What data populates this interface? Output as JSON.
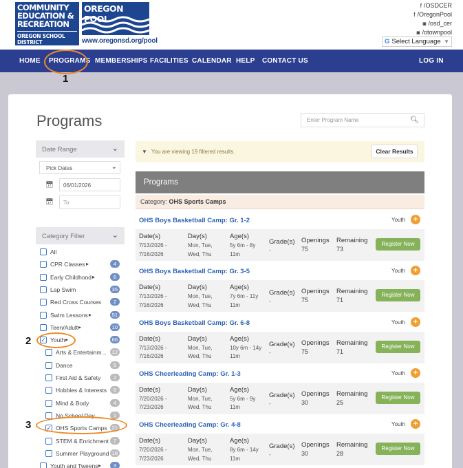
{
  "header": {
    "logo_lines": [
      "COMMUNITY",
      "EDUCATION &",
      "RECREATION"
    ],
    "logo_sub": "OREGON SCHOOL DISTRICT",
    "pool_logo": "OREGON POOL",
    "pool_url": "www.oregonsd.org/pool",
    "social": [
      "/OSDCER",
      "/OregonPool",
      "/osd_cer",
      "/otownpool"
    ],
    "social_icons": [
      "facebook-icon",
      "facebook-icon",
      "instagram-icon",
      "instagram-icon"
    ],
    "language_label": "Select Language",
    "language_arrow": "▼"
  },
  "nav": {
    "items": [
      "HOME",
      "PROGRAMS",
      "MEMBERSHIPS",
      "FACILITIES",
      "CALENDAR",
      "HELP",
      "CONTACT US"
    ],
    "login": "LOG IN"
  },
  "annotations": {
    "n1": "1",
    "n2": "2",
    "n3": "3"
  },
  "page": {
    "title": "Programs",
    "search_placeholder": "Enter Program Name"
  },
  "sidebar": {
    "date_range": {
      "header": "Date Range",
      "pick_dates": "Pick Dates",
      "start": "06/01/2026",
      "end_placeholder": "To"
    },
    "category": {
      "header": "Category Filter",
      "items": [
        {
          "label": "All",
          "count": "",
          "checked": false,
          "arrow": false
        },
        {
          "label": "CPR Classes",
          "count": "4",
          "checked": false,
          "arrow": true
        },
        {
          "label": "Early Childhood",
          "count": "6",
          "checked": false,
          "arrow": true
        },
        {
          "label": "Lap Swim",
          "count": "35",
          "checked": false,
          "arrow": false
        },
        {
          "label": "Red Cross Courses",
          "count": "2",
          "checked": false,
          "arrow": false
        },
        {
          "label": "Swim Lessons",
          "count": "51",
          "checked": false,
          "arrow": true
        },
        {
          "label": "Teen/Adult",
          "count": "10",
          "checked": false,
          "arrow": true
        },
        {
          "label": "Youth",
          "count": "66",
          "checked": true,
          "arrow": true
        }
      ],
      "youth_sub": [
        {
          "label": "Arts & Entertainm...",
          "count": "12",
          "checked": false
        },
        {
          "label": "Dance",
          "count": "5",
          "checked": false
        },
        {
          "label": "First Aid & Safety",
          "count": "2",
          "checked": false
        },
        {
          "label": "Hobbies & Interests",
          "count": "6",
          "checked": false
        },
        {
          "label": "Mind & Body",
          "count": "4",
          "checked": false
        },
        {
          "label": "No School Day",
          "count": "1",
          "checked": false
        },
        {
          "label": "OHS Sports Camps",
          "count": "21",
          "checked": true
        },
        {
          "label": "STEM & Enrichment",
          "count": "7",
          "checked": false
        },
        {
          "label": "Summer Playground",
          "count": "18",
          "checked": false
        }
      ],
      "last": {
        "label": "Youth and Tweens",
        "count": "3",
        "checked": false,
        "arrow": true
      }
    }
  },
  "results": {
    "filter_message": "You are viewing 19 filtered results.",
    "clear_label": "Clear Results",
    "section_title": "Programs",
    "category_label": "Category:",
    "category_value": "OHS Sports Camps",
    "headers": {
      "dates": "Date(s)",
      "days": "Day(s)",
      "ages": "Age(s)",
      "grades": "Grade(s)",
      "openings": "Openings",
      "remaining": "Remaining"
    },
    "register_label": "Register Now",
    "programs": [
      {
        "title": "OHS Boys Basketball Camp: Gr. 1-2",
        "tag": "Youth",
        "date1": "7/13/2026 -",
        "date2": "7/16/2026",
        "days1": "Mon, Tue,",
        "days2": "Wed, Thu",
        "age1": "5y 6m - 8y",
        "age2": "11m",
        "grade": "-",
        "openings": "75",
        "remaining": "73"
      },
      {
        "title": "OHS Boys Basketball Camp: Gr. 3-5",
        "tag": "Youth",
        "date1": "7/13/2026 -",
        "date2": "7/16/2026",
        "days1": "Mon, Tue,",
        "days2": "Wed, Thu",
        "age1": "7y 6m - 11y",
        "age2": "11m",
        "grade": "-",
        "openings": "75",
        "remaining": "71"
      },
      {
        "title": "OHS Boys Basketball Camp: Gr. 6-8",
        "tag": "Youth",
        "date1": "7/13/2026 -",
        "date2": "7/16/2026",
        "days1": "Mon, Tue,",
        "days2": "Wed, Thu",
        "age1": "10y 6m - 14y",
        "age2": "11m",
        "grade": "-",
        "openings": "75",
        "remaining": "71"
      },
      {
        "title": "OHS Cheerleading Camp: Gr. 1-3",
        "tag": "Youth",
        "date1": "7/20/2026 -",
        "date2": "7/23/2026",
        "days1": "Mon, Tue,",
        "days2": "Wed, Thu",
        "age1": "5y 6m - 9y",
        "age2": "11m",
        "grade": "-",
        "openings": "30",
        "remaining": "25"
      },
      {
        "title": "OHS Cheerleading Camp: Gr. 4-8",
        "tag": "Youth",
        "date1": "7/20/2026 -",
        "date2": "7/23/2026",
        "days1": "Mon, Tue,",
        "days2": "Wed, Thu",
        "age1": "8y 6m - 14y",
        "age2": "11m",
        "grade": "-",
        "openings": "30",
        "remaining": "28"
      }
    ]
  }
}
